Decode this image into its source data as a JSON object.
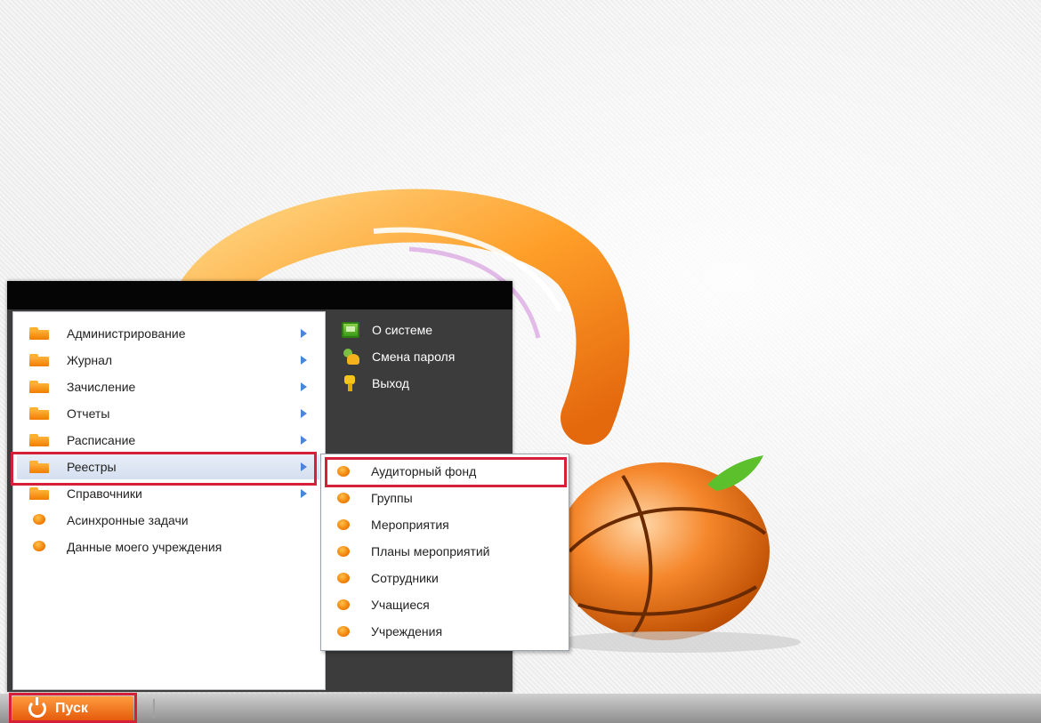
{
  "start_menu": {
    "items": [
      {
        "label": "Администрирование",
        "icon": "folder-icon",
        "has_submenu": true
      },
      {
        "label": "Журнал",
        "icon": "folder-icon",
        "has_submenu": true
      },
      {
        "label": "Зачисление",
        "icon": "folder-icon",
        "has_submenu": true
      },
      {
        "label": "Отчеты",
        "icon": "folder-icon",
        "has_submenu": true
      },
      {
        "label": "Расписание",
        "icon": "folder-icon",
        "has_submenu": true
      },
      {
        "label": "Реестры",
        "icon": "folder-icon",
        "has_submenu": true,
        "selected": true
      },
      {
        "label": "Справочники",
        "icon": "folder-icon",
        "has_submenu": true
      },
      {
        "label": "Асинхронные задачи",
        "icon": "orange-dot-icon",
        "has_submenu": false
      },
      {
        "label": "Данные моего учреждения",
        "icon": "orange-dot-icon",
        "has_submenu": false
      }
    ],
    "right_items": [
      {
        "label": "О системе",
        "icon": "monitor-icon"
      },
      {
        "label": "Смена пароля",
        "icon": "users-icon"
      },
      {
        "label": "Выход",
        "icon": "key-icon"
      }
    ]
  },
  "submenu": {
    "items": [
      {
        "label": "Аудиторный фонд",
        "icon": "orange-dot-icon",
        "highlighted": true
      },
      {
        "label": "Группы",
        "icon": "orange-dot-icon"
      },
      {
        "label": "Мероприятия",
        "icon": "orange-dot-icon"
      },
      {
        "label": "Планы мероприятий",
        "icon": "orange-dot-icon"
      },
      {
        "label": "Сотрудники",
        "icon": "orange-dot-icon"
      },
      {
        "label": "Учащиеся",
        "icon": "orange-dot-icon"
      },
      {
        "label": "Учреждения",
        "icon": "orange-dot-icon"
      }
    ]
  },
  "taskbar": {
    "start_label": "Пуск"
  },
  "colors": {
    "accent_orange": "#f07d00",
    "highlight_red": "#d6203a",
    "menu_dark": "#3c3c3c",
    "submenu_arrow": "#4a86d8"
  }
}
